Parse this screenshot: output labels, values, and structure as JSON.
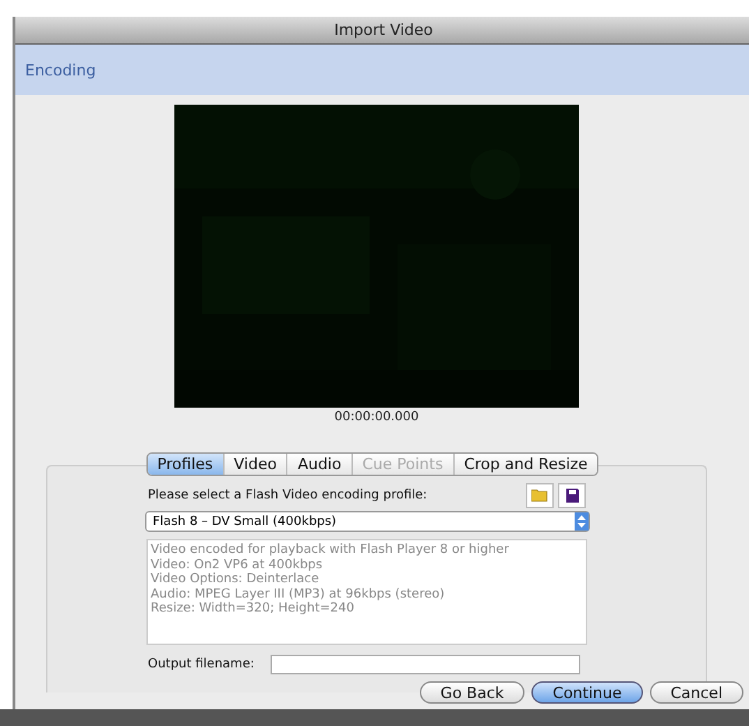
{
  "window": {
    "title": "Import Video"
  },
  "step": {
    "title": "Encoding"
  },
  "preview": {
    "timecode": "00:00:00.000"
  },
  "tabs": [
    {
      "label": "Profiles",
      "selected": true,
      "disabled": false
    },
    {
      "label": "Video",
      "selected": false,
      "disabled": false
    },
    {
      "label": "Audio",
      "selected": false,
      "disabled": false
    },
    {
      "label": "Cue Points",
      "selected": false,
      "disabled": true
    },
    {
      "label": "Crop and Resize",
      "selected": false,
      "disabled": false
    }
  ],
  "profile": {
    "label": "Please select a Flash Video encoding profile:",
    "value": "Flash 8 – DV Small (400kbps)",
    "description": [
      "Video encoded for playback with Flash Player 8 or higher",
      "Video: On2 VP6 at 400kbps",
      "Video Options: Deinterlace",
      "Audio: MPEG Layer III (MP3) at 96kbps (stereo)",
      "Resize: Width=320; Height=240"
    ]
  },
  "output": {
    "label": "Output filename:"
  },
  "buttons": [
    {
      "label": "Go Back",
      "default": false
    },
    {
      "label": "Continue",
      "default": true
    },
    {
      "label": "Cancel",
      "default": false
    }
  ]
}
